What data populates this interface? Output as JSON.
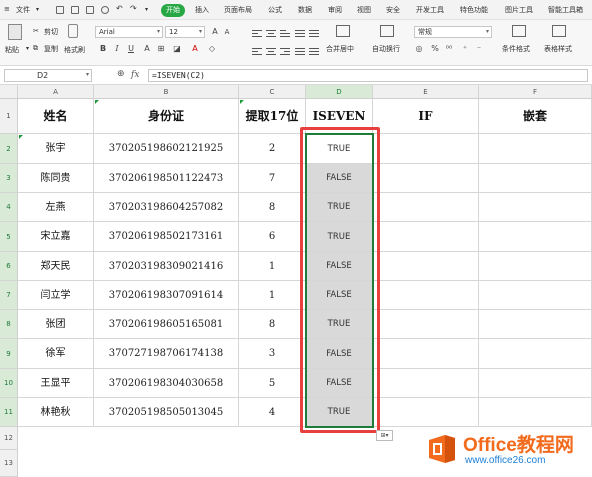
{
  "menu": {
    "file_label": "文件",
    "start_label": "开始",
    "tabs": [
      "插入",
      "页面布局",
      "公式",
      "数据",
      "审阅",
      "视图",
      "安全",
      "开发工具",
      "特色功能",
      "图片工具",
      "智能工具箱"
    ]
  },
  "ribbon": {
    "paste_label": "粘贴",
    "cut_label": "剪切",
    "copy_label": "复制",
    "format_painter_label": "格式刷",
    "font_name": "Arial",
    "font_size": "12",
    "number_format": "常规",
    "merge_label": "合并居中",
    "wrap_label": "自动换行",
    "cond_format_label": "条件格式",
    "table_style_label": "表格样式",
    "percent_symbol": "%"
  },
  "formula_bar": {
    "name_box": "D2",
    "fx_label": "fx",
    "formula": "=ISEVEN(C2)"
  },
  "sheet": {
    "columns": [
      "A",
      "B",
      "C",
      "D",
      "E",
      "F"
    ],
    "row_numbers": [
      "1",
      "2",
      "3",
      "4",
      "5",
      "6",
      "7",
      "8",
      "9",
      "10",
      "11",
      "12",
      "13"
    ],
    "headers": {
      "a": "姓名",
      "b": "身份证",
      "c": "提取17位",
      "d": "ISEVEN",
      "e": "IF",
      "f": "嵌套"
    },
    "rows": [
      {
        "name": "张宇",
        "id": "370205198602121925",
        "digit": "2",
        "iseven": "TRUE"
      },
      {
        "name": "陈同贵",
        "id": "370206198501122473",
        "digit": "7",
        "iseven": "FALSE"
      },
      {
        "name": "左燕",
        "id": "370203198604257082",
        "digit": "8",
        "iseven": "TRUE"
      },
      {
        "name": "宋立嘉",
        "id": "370206198502173161",
        "digit": "6",
        "iseven": "TRUE"
      },
      {
        "name": "郑天民",
        "id": "370203198309021416",
        "digit": "1",
        "iseven": "FALSE"
      },
      {
        "name": "闫立学",
        "id": "370206198307091614",
        "digit": "1",
        "iseven": "FALSE"
      },
      {
        "name": "张团",
        "id": "370206198605165081",
        "digit": "8",
        "iseven": "TRUE"
      },
      {
        "name": "徐军",
        "id": "370727198706174138",
        "digit": "3",
        "iseven": "FALSE"
      },
      {
        "name": "王显平",
        "id": "370206198304030658",
        "digit": "5",
        "iseven": "FALSE"
      },
      {
        "name": "林艳秋",
        "id": "370205198505013045",
        "digit": "4",
        "iseven": "TRUE"
      }
    ]
  },
  "watermark": {
    "brand": "Office教程网",
    "url": "www.office26.com"
  },
  "colors": {
    "accent_green": "#27a845",
    "highlight_red": "#e8403e",
    "logo_orange": "#f26b1d",
    "logo_blue": "#1c7fd6"
  }
}
